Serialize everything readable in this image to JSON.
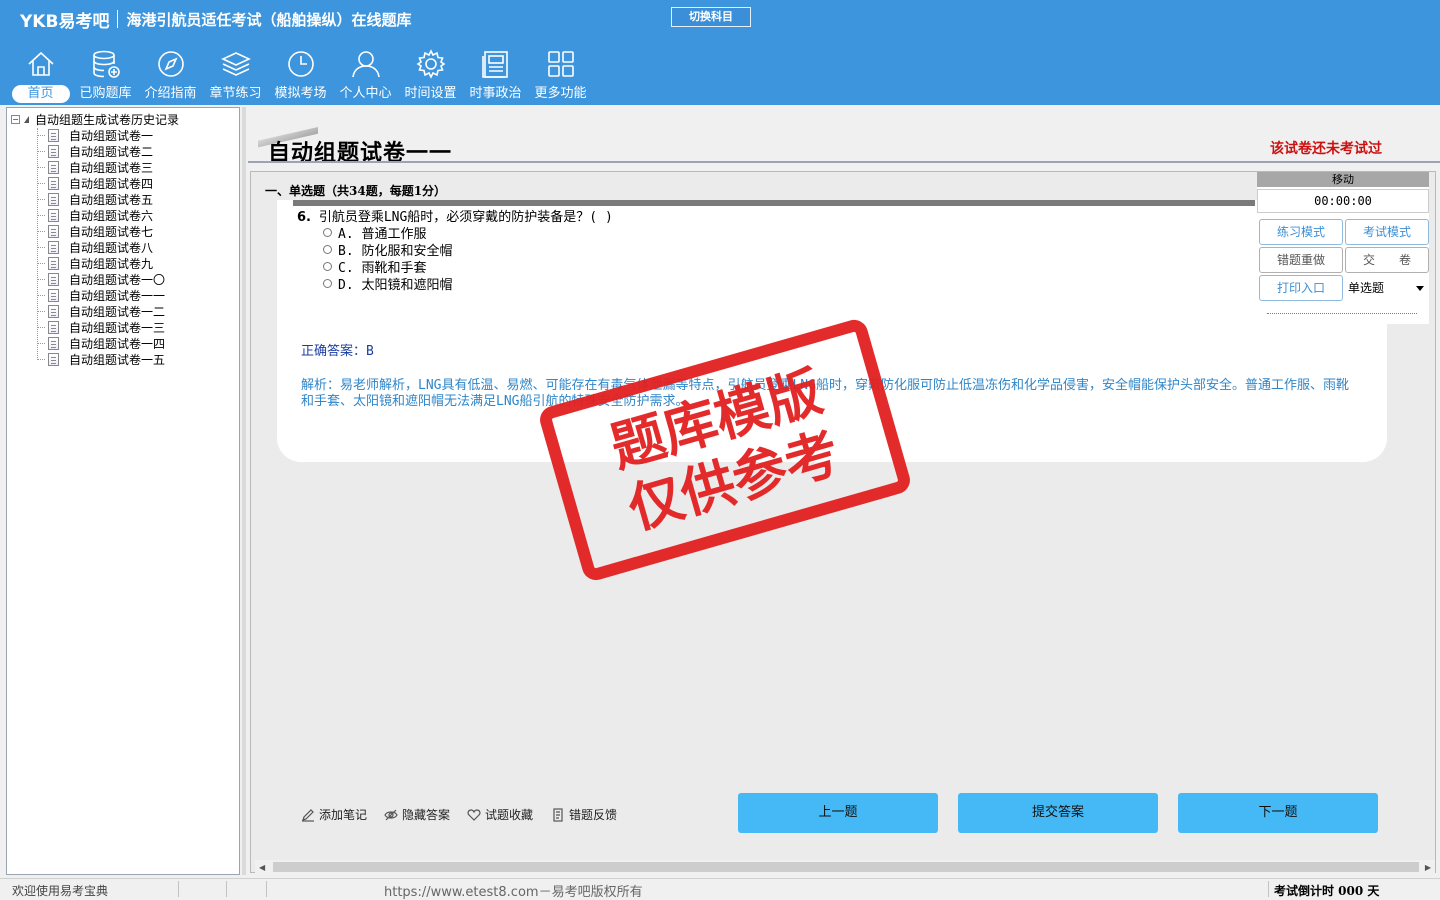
{
  "header": {
    "logo": "YKB易考吧",
    "title": "海港引航员适任考试（船舶操纵）在线题库",
    "switch_label": "切换科目"
  },
  "nav": {
    "items": [
      {
        "label": "首页",
        "icon": "home-icon"
      },
      {
        "label": "已购题库",
        "icon": "database-icon"
      },
      {
        "label": "介绍指南",
        "icon": "compass-icon"
      },
      {
        "label": "章节练习",
        "icon": "layers-icon"
      },
      {
        "label": "模拟考场",
        "icon": "clock-icon"
      },
      {
        "label": "个人中心",
        "icon": "user-icon"
      },
      {
        "label": "时间设置",
        "icon": "gear-icon"
      },
      {
        "label": "时事政治",
        "icon": "news-icon"
      },
      {
        "label": "更多功能",
        "icon": "grid-icon"
      }
    ]
  },
  "tree": {
    "root": "自动组题生成试卷历史记录",
    "items": [
      "自动组题试卷一",
      "自动组题试卷二",
      "自动组题试卷三",
      "自动组题试卷四",
      "自动组题试卷五",
      "自动组题试卷六",
      "自动组题试卷七",
      "自动组题试卷八",
      "自动组题试卷九",
      "自动组题试卷一〇",
      "自动组题试卷一一",
      "自动组题试卷一二",
      "自动组题试卷一三",
      "自动组题试卷一四",
      "自动组题试卷一五"
    ]
  },
  "paper": {
    "title": "自动组题试卷一一",
    "status": "该试卷还未考试过",
    "section": "一、单选题（共34题，每题1分）"
  },
  "question": {
    "number": "6.",
    "text": "引航员登乘LNG船时，必须穿戴的防护装备是？( )",
    "options": [
      "A. 普通工作服",
      "B. 防化服和安全帽",
      "C. 雨靴和手套",
      "D. 太阳镜和遮阳帽"
    ],
    "answer": "正确答案：B",
    "analysis": "解析：易老师解析，LNG具有低温、易燃、可能存在有毒气体泄漏等特点，引航员登乘LNG船时，穿戴防化服可防止低温冻伤和化学品侵害，安全帽能保护头部安全。普通工作服、雨靴和手套、太阳镜和遮阳帽无法满足LNG船引航的特殊安全防护需求。"
  },
  "panel": {
    "head": "移动",
    "timer": "00:00:00",
    "practice_mode": "练习模式",
    "exam_mode": "考试模式",
    "redo_wrong": "错题重做",
    "submit_paper": "交　　卷",
    "print": "打印入口",
    "type_select": "单选题"
  },
  "tools": {
    "add_note": "添加笔记",
    "hide_answer": "隐藏答案",
    "favorite": "试题收藏",
    "feedback": "错题反馈"
  },
  "buttons": {
    "prev": "上一题",
    "submit": "提交答案",
    "next": "下一题"
  },
  "stamp": {
    "line1": "题库模版",
    "line2": "仅供参考"
  },
  "statusbar": {
    "welcome": "欢迎使用易考宝典",
    "copyright": "https://www.etest8.com－易考吧版权所有",
    "countdown": "考试倒计时 000 天"
  },
  "colors": {
    "header": "#3d95dd",
    "button": "#45b9f5",
    "stamp": "#e32020",
    "status": "#cc1111"
  }
}
